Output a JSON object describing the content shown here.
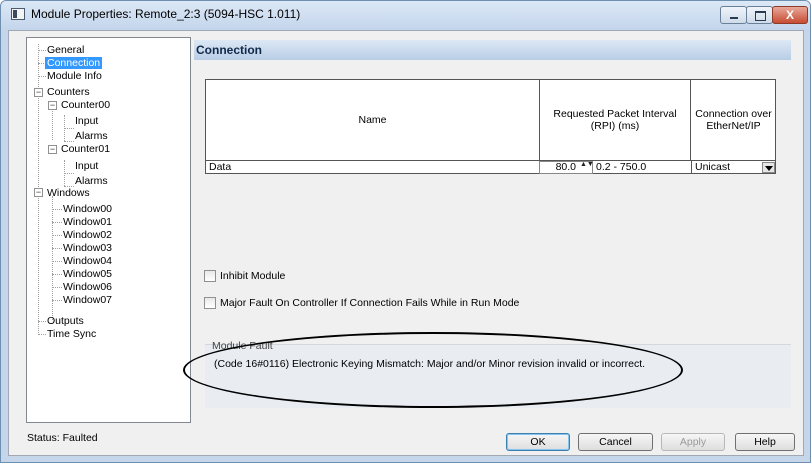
{
  "window": {
    "title": "Module Properties: Remote_2:3 (5094-HSC 1.011)",
    "close_glyph": "X"
  },
  "tree": {
    "items": [
      {
        "label": "General"
      },
      {
        "label": "Connection"
      },
      {
        "label": "Module Info"
      },
      {
        "label": "Counters",
        "expander": "−"
      },
      {
        "label": "Counter00",
        "expander": "−"
      },
      {
        "label": "Input"
      },
      {
        "label": "Alarms"
      },
      {
        "label": "Counter01",
        "expander": "−"
      },
      {
        "label": "Input"
      },
      {
        "label": "Alarms"
      },
      {
        "label": "Windows",
        "expander": "−"
      },
      {
        "label": "Window00"
      },
      {
        "label": "Window01"
      },
      {
        "label": "Window02"
      },
      {
        "label": "Window03"
      },
      {
        "label": "Window04"
      },
      {
        "label": "Window05"
      },
      {
        "label": "Window06"
      },
      {
        "label": "Window07"
      },
      {
        "label": "Outputs"
      },
      {
        "label": "Time Sync"
      }
    ],
    "selected": "Connection"
  },
  "section": {
    "title": "Connection"
  },
  "connection_table": {
    "headers": {
      "name": "Name",
      "rpi": "Requested Packet Interval (RPI) (ms)",
      "conn": "Connection over EtherNet/IP"
    },
    "row": {
      "name": "Data",
      "rpi_value": "80.0",
      "spin_glyph": "▲▼",
      "rpi_range": "0.2 - 750.0",
      "connection": "Unicast"
    }
  },
  "options": {
    "inhibit_label": "Inhibit Module",
    "inhibit_checked": false,
    "major_fault_label": "Major Fault On Controller If Connection Fails While in Run Mode",
    "major_fault_checked": false
  },
  "module_fault": {
    "title": "Module Fault",
    "text": "(Code 16#0116) Electronic Keying Mismatch: Major and/or Minor revision invalid or incorrect."
  },
  "status": {
    "text": "Status:  Faulted"
  },
  "buttons": {
    "ok": "OK",
    "cancel": "Cancel",
    "apply": "Apply",
    "help": "Help"
  },
  "colors": {
    "selection": "#3399ff",
    "header_text": "#10284a",
    "annotation_ellipse": "#000000"
  }
}
